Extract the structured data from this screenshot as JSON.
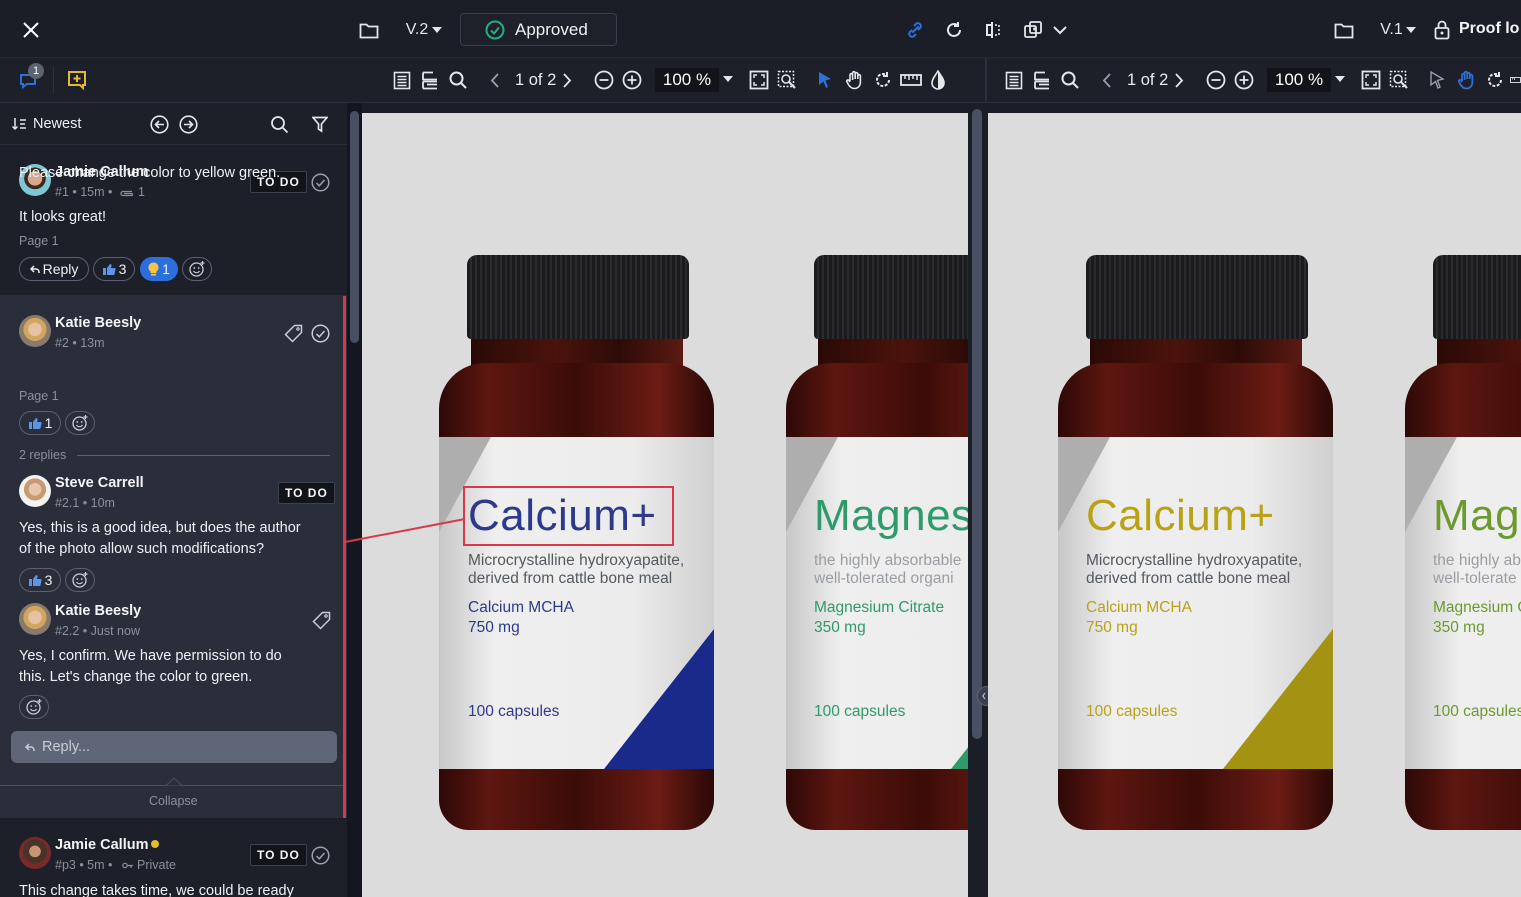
{
  "topbar": {
    "left_version": "V.2",
    "left_status": "Approved",
    "right_version": "V.1",
    "right_status": "Proof lo",
    "icons": [
      "close-icon",
      "folder-icon",
      "approved-check-icon",
      "link-icon",
      "refresh-icon",
      "compare-split-icon",
      "overlay-compare-icon",
      "chevron-down-icon",
      "folder-icon",
      "lock-icon"
    ]
  },
  "sidebar_tabs": {
    "comments_badge": "1"
  },
  "left_viewer": {
    "page_indicator": "1 of 2",
    "zoom": "100 %"
  },
  "right_viewer": {
    "page_indicator": "1 of 2",
    "zoom": "100 %"
  },
  "sidebar": {
    "sort_label": "Newest",
    "collapse_label": "Collapse",
    "reply_placeholder": "Reply...",
    "replies_count": "2 replies",
    "comments": [
      {
        "author": "Jamie Callum",
        "meta": "#1 • 15m •",
        "attachments": "1",
        "body": "It looks great!",
        "page": "Page 1",
        "status": "TO DO",
        "reply_label": "Reply",
        "reactions": [
          {
            "icon": "thumbs-up",
            "count": "3"
          },
          {
            "icon": "lightbulb",
            "count": "1"
          }
        ]
      },
      {
        "author": "Katie Beesly",
        "meta": "#2 • 13m",
        "body": "Please change the color to yellow green.",
        "page": "Page 1",
        "reactions": [
          {
            "icon": "thumbs-up",
            "count": "1"
          }
        ]
      },
      {
        "author": "Steve Carrell",
        "meta": "#2.1 • 10m",
        "body_line1": "Yes, this is a good idea, but does the author",
        "body_line2": "of the photo allow such modifications?",
        "status": "TO DO",
        "reactions": [
          {
            "icon": "thumbs-up",
            "count": "3"
          }
        ]
      },
      {
        "author": "Katie Beesly",
        "meta": "#2.2 • Just now",
        "body_line1": "Yes, I confirm. We have permission to do",
        "body_line2": "this. Let's change the color to green."
      },
      {
        "author": "Jamie Callum",
        "meta": "#p3 • 5m •",
        "private_label": "Private",
        "body": "This change takes time, we could be ready",
        "status": "TO DO"
      }
    ]
  },
  "product_left": {
    "calcium": {
      "title": "Calcium+",
      "sub1": "Microcrystalline hydroxyapatite,",
      "sub2": "derived from cattle bone meal",
      "ingredient": "Calcium MCHA",
      "dose": "750 mg",
      "count": "100 capsules",
      "accent": "#2d3a8c"
    },
    "magnesium": {
      "title": "Magnes",
      "sub1": "the highly absorbable",
      "sub2": "well-tolerated organi",
      "ingredient": "Magnesium Citrate",
      "dose": "350 mg",
      "count": "100 capsules",
      "accent": "#2f9a6a"
    }
  },
  "product_right": {
    "calcium": {
      "title": "Calcium+",
      "sub1": "Microcrystalline hydroxyapatite,",
      "sub2": "derived from cattle bone meal",
      "ingredient": "Calcium MCHA",
      "dose": "750 mg",
      "count": "100 capsules",
      "accent": "#b9a216"
    },
    "magnesium": {
      "title": "Mag",
      "sub1": "the highly ab",
      "sub2": "well-tolerate",
      "ingredient": "Magnesium C",
      "dose": "350 mg",
      "count": "100 capsules",
      "accent": "#6d9a2e"
    }
  },
  "colors": {
    "annotation_red": "#d8384a",
    "link_blue": "#2a6fdd",
    "approved_green": "#22b07d",
    "add_comment_yellow": "#e3b92f"
  }
}
